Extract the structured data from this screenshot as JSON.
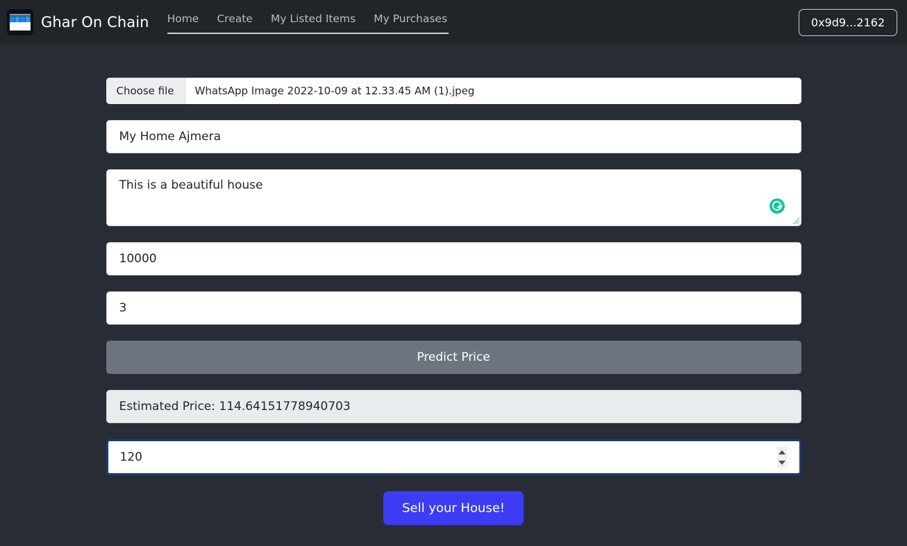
{
  "navbar": {
    "brand": "Ghar On Chain",
    "logo_icon": "storefront-icon",
    "links": [
      {
        "label": "Home"
      },
      {
        "label": "Create"
      },
      {
        "label": "My Listed Items"
      },
      {
        "label": "My Purchases"
      }
    ],
    "wallet": "0x9d9...2162"
  },
  "form": {
    "file": {
      "button_label": "Choose file",
      "filename": "WhatsApp Image 2022-10-09 at 12.33.45 AM (1).jpeg"
    },
    "name_value": "My Home Ajmera",
    "description_value": "This is a beautiful house",
    "grammarly_icon": "grammarly-icon",
    "area_value": "10000",
    "bedrooms_value": "3",
    "predict_button": "Predict Price",
    "estimate": "Estimated Price: 114.64151778940703",
    "price_value": "120",
    "submit_button": "Sell your House!"
  },
  "colors": {
    "navbar_bg": "#212529",
    "page_bg": "#282c34",
    "primary": "#3c3cf5",
    "secondary": "#6c757d",
    "estimate_bg": "#e9ecef",
    "focus_border": "#1c3c7c",
    "grammarly_green": "#15c39a"
  }
}
